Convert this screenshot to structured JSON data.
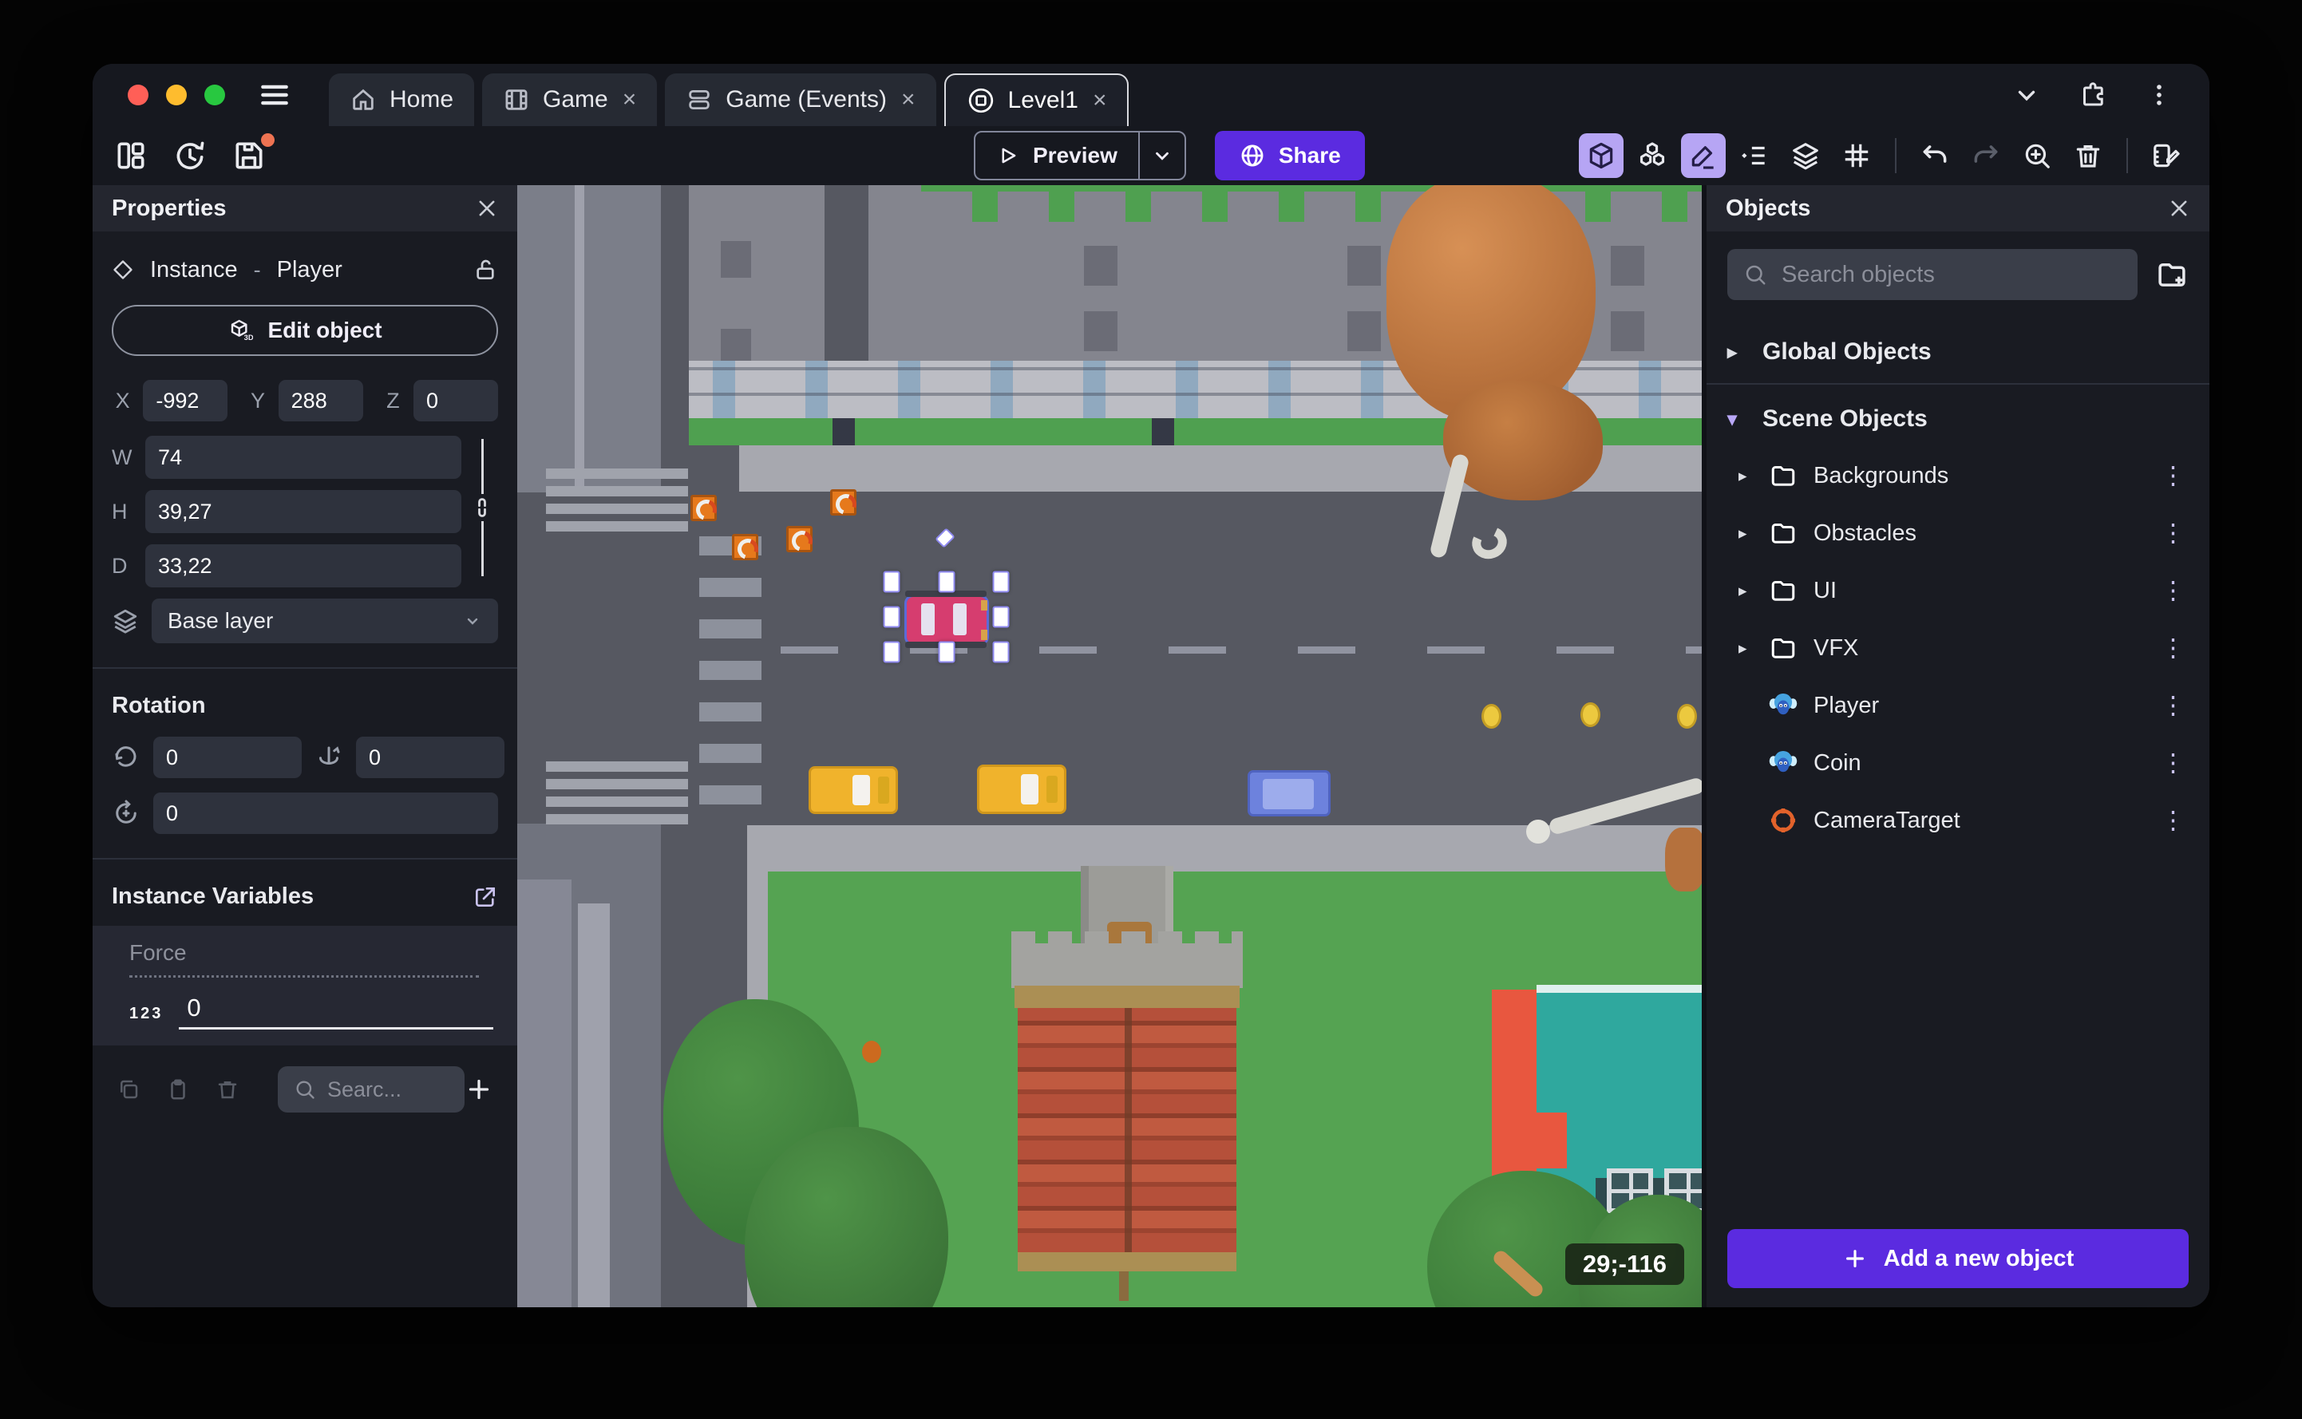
{
  "ui": {
    "close_glyph": "×",
    "kebab_glyph": "⋮",
    "tri_right": "▸",
    "tri_down": "▾"
  },
  "colors": {
    "accent_purple": "#5b2be0",
    "active_tool_lavender": "#b6a5f4",
    "unsaved_badge_orange": "#ee7352",
    "selection_handle": "#ffffff",
    "camera_target_orange": "#e2622b",
    "traffic_red": "#ff5f57",
    "traffic_yellow": "#febc2e",
    "traffic_green": "#28c840",
    "coin_gold": "#ecc93f"
  },
  "titlebar": {
    "tabs": [
      {
        "label": "Home",
        "closable": false
      },
      {
        "label": "Game",
        "closable": true
      },
      {
        "label": "Game (Events)",
        "closable": true
      },
      {
        "label": "Level1",
        "closable": true,
        "active": true
      }
    ]
  },
  "toolbar": {
    "preview_label": "Preview",
    "share_label": "Share"
  },
  "properties": {
    "title": "Properties",
    "instance_type": "Instance",
    "separator": "-",
    "instance_name": "Player",
    "edit_object_label": "Edit object",
    "x_label": "X",
    "x": "-992",
    "y_label": "Y",
    "y": "288",
    "z_label": "Z",
    "z": "0",
    "w_label": "W",
    "w": "74",
    "h_label": "H",
    "h": "39,27",
    "d_label": "D",
    "d": "33,22",
    "layer": "Base layer",
    "rotation_title": "Rotation",
    "rot_x": "0",
    "rot_y": "0",
    "rot_z": "0",
    "variables_title": "Instance Variables",
    "variables": [
      {
        "name": "Force",
        "type_label": "123",
        "value": "0"
      }
    ],
    "variables_search_placeholder": "Searc..."
  },
  "objects_panel": {
    "title": "Objects",
    "search_placeholder": "Search objects",
    "global_group_label": "Global Objects",
    "scene_group_label": "Scene Objects",
    "scene_items": [
      {
        "kind": "folder",
        "label": "Backgrounds"
      },
      {
        "kind": "folder",
        "label": "Obstacles"
      },
      {
        "kind": "folder",
        "label": "UI"
      },
      {
        "kind": "folder",
        "label": "VFX"
      },
      {
        "kind": "object",
        "icon": "monkey-icon",
        "label": "Player"
      },
      {
        "kind": "object",
        "icon": "monkey-icon",
        "label": "Coin"
      },
      {
        "kind": "object",
        "icon": "camera-target-icon",
        "label": "CameraTarget"
      }
    ],
    "add_button_label": "Add a new object"
  },
  "canvas": {
    "selected_instance": "Player",
    "coords_badge": "29;-116"
  }
}
